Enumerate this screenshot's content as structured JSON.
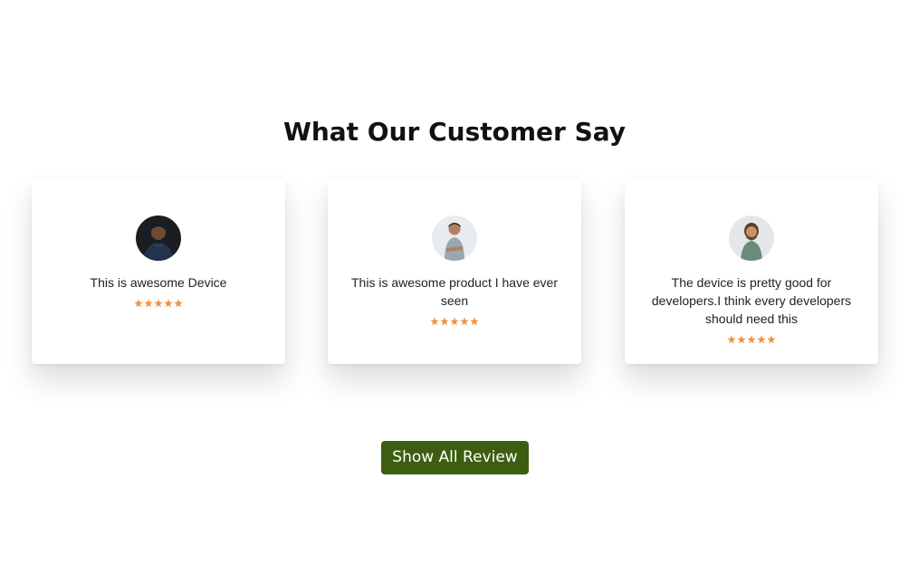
{
  "section": {
    "title": "What Our Customer Say"
  },
  "reviews": [
    {
      "avatar_icon": "person-avatar-dark-hoodie",
      "text": "This is awesome Device",
      "rating": 5,
      "max_rating": 5
    },
    {
      "avatar_icon": "person-avatar-arms-crossed",
      "text": "This is awesome product I have ever seen",
      "rating": 5,
      "max_rating": 5
    },
    {
      "avatar_icon": "person-avatar-bearded",
      "text": "The device is pretty good for developers.I think every developers should need this",
      "rating": 5,
      "max_rating": 5
    }
  ],
  "actions": {
    "show_all_label": "Show All Review"
  },
  "colors": {
    "star": "#f0923a",
    "button_bg": "#3d5e12",
    "button_text": "#ffffff",
    "title": "#111111"
  }
}
